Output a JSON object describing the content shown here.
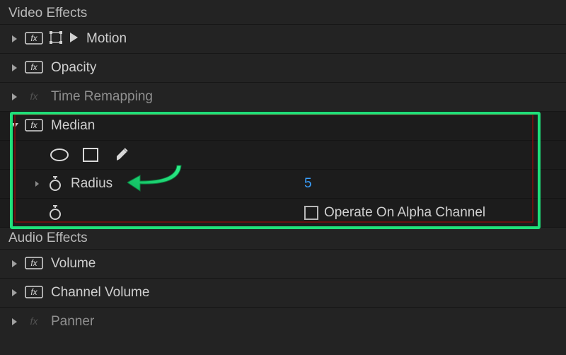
{
  "sections": {
    "video": {
      "title": "Video Effects"
    },
    "audio": {
      "title": "Audio Effects"
    }
  },
  "videoEffects": {
    "motion": {
      "label": "Motion"
    },
    "opacity": {
      "label": "Opacity"
    },
    "timeRemapping": {
      "label": "Time Remapping"
    },
    "median": {
      "label": "Median",
      "radius": {
        "label": "Radius",
        "value": "5"
      },
      "alpha": {
        "label": "Operate On Alpha Channel",
        "checked": false
      }
    }
  },
  "audioEffects": {
    "volume": {
      "label": "Volume"
    },
    "channelVolume": {
      "label": "Channel Volume"
    },
    "panner": {
      "label": "Panner"
    }
  }
}
